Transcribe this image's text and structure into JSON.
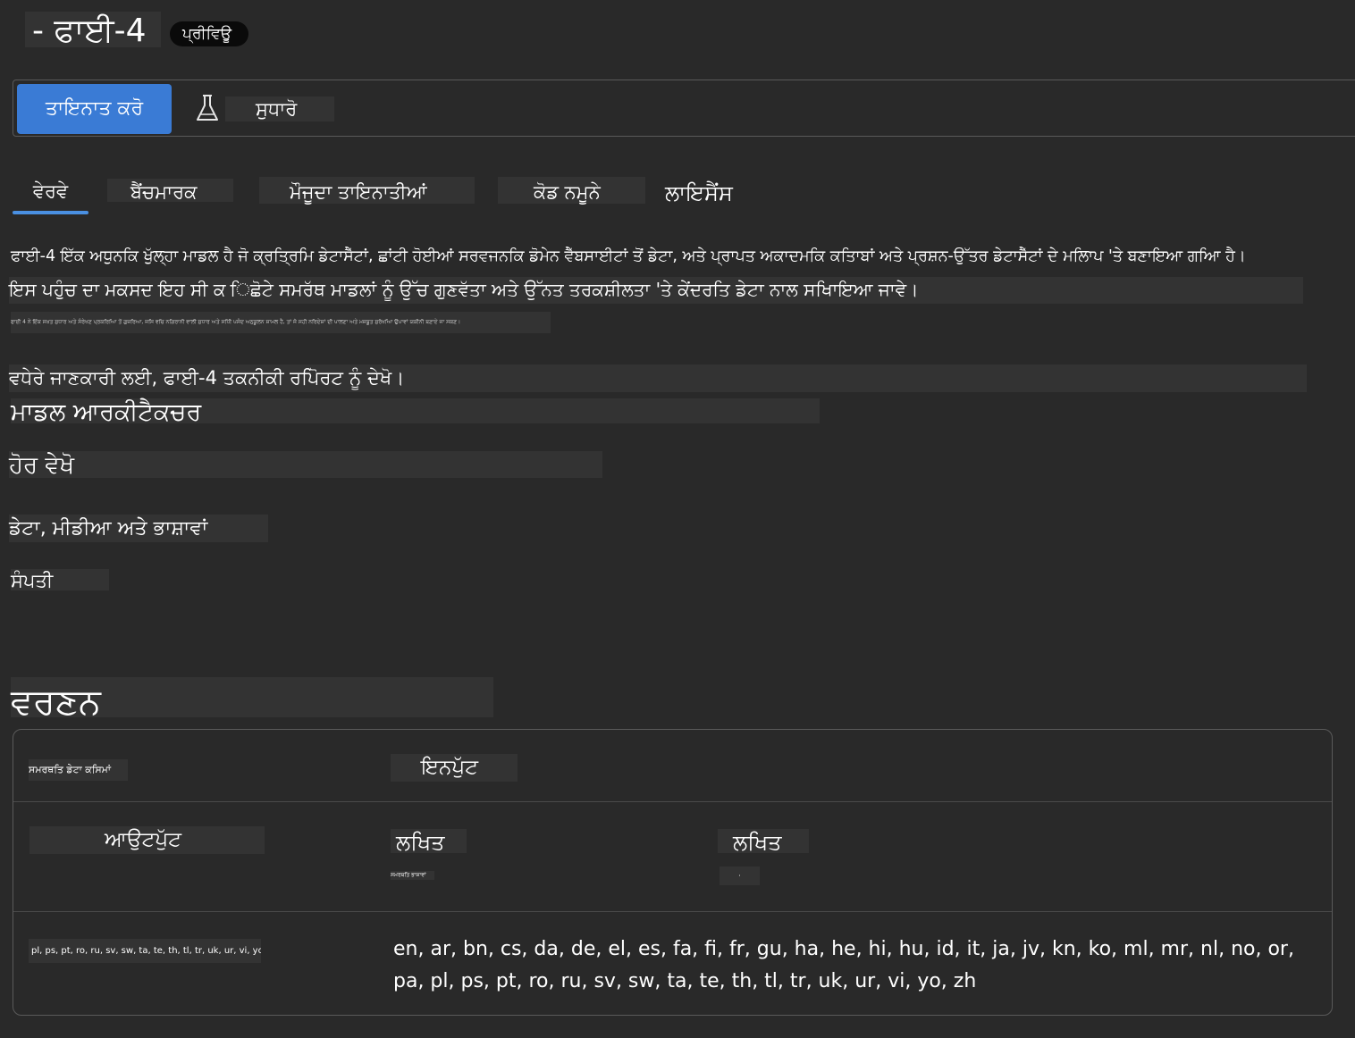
{
  "header": {
    "title": "- ਫਾਈ-4",
    "badge": "ਪ੍ਰੀਵਿਊ"
  },
  "toolbar": {
    "deploy_label": "ਤਾਇਨਾਤ ਕਰੋ",
    "improve_label": "ਸੁਧਾਰੋ"
  },
  "tabs": [
    {
      "label": "ਵੇਰਵੇ",
      "active": true
    },
    {
      "label": "ਬੈਂਚਮਾਰਕ"
    },
    {
      "label": "ਮੌਜੂਦਾ ਤਾਇਨਾਤੀਆਂ"
    },
    {
      "label": "ਕੋਡ ਨਮੂਨੇ"
    },
    {
      "label": "ਲਾਇਸੈਂਸ"
    }
  ],
  "details": {
    "para1": "ਫਾਈ-4 ਇੱਕ ਅਧੁਨਕਿ ਖੁੱਲ੍ਹਾ ਮਾਡਲ ਹੈ ਜੋ ਕ੍ਰਤ੍ਰਿਮਿ ਡੇਟਾਸੈੱਟਾਂ, ਛਾਂਟੀ ਹੋਈਆਂ ਸਰਵਜਨਕਿ ਡੋਮੇਨ ਵੈੱਬਸਾਈਟਾਂ ਤੋਂ ਡੇਟਾ, ਅਤੇ ਪ੍ਰਾਪਤ ਅਕਾਦਮਕਿ ਕਤਿਾਬਾਂ ਅਤੇ ਪ੍ਰਸ਼ਨ-ਉੱਤਰ ਡੇਟਾਸੈੱਟਾਂ ਦੇ ਮਲਿਾਪ 'ਤੇ ਬਣਾਇਆ ਗਆਿ ਹੈ।",
    "para2": "ਇਸ ਪਹੁੰਚ ਦਾ ਮਕਸਦ ਇਹ ਸੀ ਕ ਿਛੋਟੇ ਸਮਰੱਥ ਮਾਡਲਾਂ ਨੂੰ ਉੱਚ ਗੁਣਵੱਤਾ ਅਤੇ ਉੱਨਤ ਤਰਕਸ਼ੀਲਤਾ 'ਤੇ ਕੇਂਦਰਤਿ ਡੇਟਾ ਨਾਲ ਸਖਿਾਇਆ ਜਾਵੇ।",
    "para3": "ਫਾਈ 4 ਨੇ ਇੱਕ ਸਖ਼ਤ ਸੁਧਾਰ ਅਤੇ ਸੰਰੇਖਣ ਪ੍ਰਕਰਿਆਿ ਤੋਂ ਗੁਜ਼ਰਿਆ, ਜਸਿ ਵਚਿ ਨਗਿਰਾਨੀ ਵਾਲੀ ਸੁਧਾਰ ਅਤੇ ਸਧਿੀ ਪਸੰਦ ਅਨੁਕੂਲਨ ਸ਼ਾਮਲ ਹੈ, ਤਾਂ ਜੋ ਸਹੀ ਨਰਿਦੇਸ਼ਾਂ ਦੀ ਪਾਲਣਾ ਅਤੇ ਮਜ਼ਬੂਤ ਸੁਰੱਖਆਿ ਉਪਾਵਾਂ ਯਕੀਨੀ ਬਣਾਏ ਜਾ ਸਕਣ।",
    "more_info": "ਵਧੇਰੇ ਜਾਣਕਾਰੀ ਲਈ, ਫਾਈ-4 ਤਕਨੀਕੀ ਰਪਿੋਰਟ ਨੂੰ ਦੇਖੋ।",
    "architecture_heading": "ਮਾਡਲ ਆਰਕੀਟੈਕਚਰ",
    "see_also": "ਹੋਰ ਵੇਖੋ",
    "data_media": "ਡੇਟਾ, ਮੀਡੀਆ ਅਤੇ ਭਾਸ਼ਾਵਾਂ",
    "property": "ਸੰਪਤੀ"
  },
  "description": {
    "heading": "ਵਰਣਨ",
    "supported_types_label": "ਸਮਰਥਤਿ ਡੇਟਾ ਕਸਿਮਾਂ",
    "input_header": "ਇਨਪੁੱਟ",
    "output_label": "ਆਉਟਪੁੱਟ",
    "input_type": "ਲਖਿਤ",
    "output_type": "ਲਖਿਤ",
    "small_note": "ਸਮਰਥਤਿ ਭਾਸ਼ਾਵਾਂ",
    "dot": "·",
    "languages_small": "pl, ps, pt, ro, ru, sv, sw, ta, te, th, tl, tr, uk, ur, vi, yo, zh",
    "languages_full": "en, ar, bn, cs, da, de, el, es, fa, fi, fr, gu, ha, he, hi, hu, id, it, ja, jv, kn, ko, ml, mr, nl, no, or, pa, pl, ps, pt, ro, ru, sv, sw, ta, te, th, tl, tr, uk, ur, vi, yo, zh"
  },
  "colors": {
    "background": "#292929",
    "accent": "#3a7bd5",
    "tab_underline": "#4a90e2"
  },
  "icons": {
    "improve": "flask-icon"
  }
}
